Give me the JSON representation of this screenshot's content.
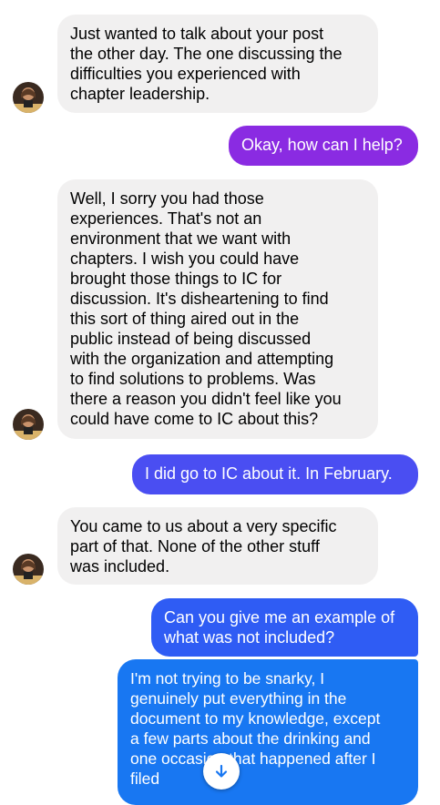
{
  "colors": {
    "incoming_bg": "#f1f0f0",
    "outgoing_purple": "#8a2be2",
    "outgoing_violet": "#6c3bf2",
    "outgoing_blue": "#2f5cf4",
    "outgoing_bright_blue": "#1877f2"
  },
  "messages": [
    {
      "sender": "them",
      "text": "Just wanted to talk about your post\nthe other day. The one discussing the\ndifficulties you experienced with\nchapter leadership."
    },
    {
      "sender": "me",
      "text": "Okay, how can I help?"
    },
    {
      "sender": "them",
      "text": "Well, I sorry you had those\nexperiences. That's not an\nenvironment that we want with\nchapters. I wish you could have\nbrought those things to IC for\ndiscussion. It's disheartening to find\nthis sort of thing aired out in the\npublic instead of being discussed\nwith the organization and attempting\nto find solutions to problems. Was\nthere a reason you didn't feel like you\ncould have come to IC about this?"
    },
    {
      "sender": "me",
      "text": "I did go to IC about it. In February."
    },
    {
      "sender": "them",
      "text": "You came to us about a very specific\npart of that. None of the other stuff\nwas included."
    },
    {
      "sender": "me",
      "text": "Can you give me an example of\nwhat was not included?"
    },
    {
      "sender": "me",
      "text": "I'm not trying to be snarky, I\ngenuinely put everything in the\ndocument to my knowledge, except\na few parts about the drinking and\none occasion that happened after I\nfiled"
    }
  ],
  "scroll_button": {
    "icon": "arrow-down-icon"
  }
}
